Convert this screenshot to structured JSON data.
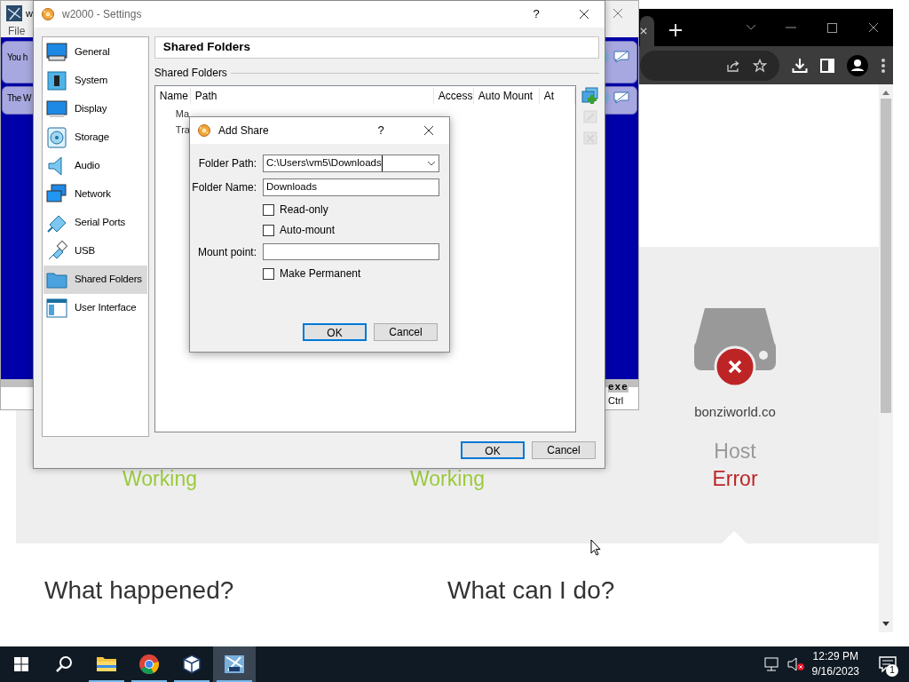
{
  "vm_window": {
    "title": "w",
    "menu": [
      "File"
    ],
    "messages": [
      "You h",
      "The W"
    ],
    "status": [
      "exe",
      "Ctrl"
    ]
  },
  "browser": {
    "page": {
      "statuses": [
        {
          "kind": "working",
          "label": "Working"
        },
        {
          "kind": "working",
          "label": "Working"
        },
        {
          "kind": "error",
          "host": "bonziworld.co",
          "role": "Host",
          "label": "Error"
        }
      ],
      "headings": [
        "What happened?",
        "What can I do?"
      ]
    }
  },
  "settings": {
    "title": "w2000 - Settings",
    "help": "?",
    "sections": [
      {
        "label": "General",
        "selected": false
      },
      {
        "label": "System",
        "selected": false
      },
      {
        "label": "Display",
        "selected": false
      },
      {
        "label": "Storage",
        "selected": false
      },
      {
        "label": "Audio",
        "selected": false
      },
      {
        "label": "Network",
        "selected": false
      },
      {
        "label": "Serial Ports",
        "selected": false
      },
      {
        "label": "USB",
        "selected": false
      },
      {
        "label": "Shared Folders",
        "selected": true
      },
      {
        "label": "User Interface",
        "selected": false
      }
    ],
    "page_title": "Shared Folders",
    "group_label": "Shared Folders",
    "columns": [
      "Name",
      "Path",
      "Access",
      "Auto Mount",
      "At"
    ],
    "rows": [
      "Ma",
      "Tra"
    ],
    "tools": [
      {
        "kind": "add",
        "disabled": false
      },
      {
        "kind": "edit",
        "disabled": true
      },
      {
        "kind": "remove",
        "disabled": true
      }
    ],
    "buttons": [
      {
        "label": "OK",
        "default": true
      },
      {
        "label": "Cancel",
        "default": false
      }
    ]
  },
  "add_share": {
    "title": "Add Share",
    "help": "?",
    "fields": [
      {
        "kind": "combo",
        "label": "Folder Path:",
        "value": "C:\\Users\\vm5\\Downloads"
      },
      {
        "kind": "text",
        "label": "Folder Name:",
        "value": "Downloads"
      },
      {
        "kind": "checkbox",
        "label": "Read-only",
        "checked": false
      },
      {
        "kind": "checkbox",
        "label": "Auto-mount",
        "checked": false
      },
      {
        "kind": "text",
        "label": "Mount point:"
      },
      {
        "kind": "checkbox",
        "label": "Make Permanent",
        "checked": false
      }
    ],
    "buttons": [
      {
        "label": "OK",
        "default": true
      },
      {
        "label": "Cancel",
        "default": false
      }
    ]
  },
  "taskbar": {
    "apps": [
      {
        "kind": "explorer",
        "running": true,
        "selected": false
      },
      {
        "kind": "chrome",
        "running": true,
        "selected": false
      },
      {
        "kind": "virtualbox",
        "running": true,
        "selected": false
      },
      {
        "kind": "vm",
        "running": true,
        "selected": true
      }
    ],
    "clock": {
      "time": "12:29 PM",
      "date": "9/16/2023"
    },
    "notifications": "1"
  }
}
